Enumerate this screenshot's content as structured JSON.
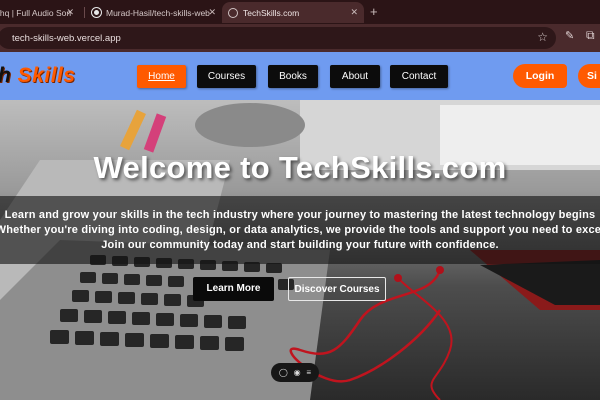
{
  "browser": {
    "tabs": [
      {
        "title": "ihq | Full Audio Son",
        "active": false
      },
      {
        "title": "Murad-Hasil/tech-skills-web",
        "active": false
      },
      {
        "title": "TechSkills.com",
        "active": true
      }
    ],
    "new_tab_symbol": "+",
    "url": "tech-skills-web.vercel.app"
  },
  "site": {
    "logo_prefix": "h",
    "logo_main": "Skills",
    "nav": [
      {
        "label": "Home",
        "active": true
      },
      {
        "label": "Courses",
        "active": false
      },
      {
        "label": "Books",
        "active": false
      },
      {
        "label": "About",
        "active": false
      },
      {
        "label": "Contact",
        "active": false
      }
    ],
    "login_label": "Login",
    "signup_label": "Si",
    "accent_color": "#ff5a00",
    "navbar_color": "#6f9bf0"
  },
  "hero": {
    "title": "Welcome to TechSkills.com",
    "lines": [
      "Learn and grow your skills in the tech industry where your journey to mastering the latest technology begins",
      "Whether you're diving into coding, design, or data analytics, we provide the tools and support you need to excel",
      "Join our community today and start building your future with confidence."
    ],
    "cta_primary": "Learn More",
    "cta_secondary": "Discover Courses"
  },
  "icons": {
    "close": "✕",
    "star": "☆",
    "pen": "✎",
    "extension": "⧉",
    "chat": "◯",
    "eye": "◉",
    "menu": "≡"
  }
}
